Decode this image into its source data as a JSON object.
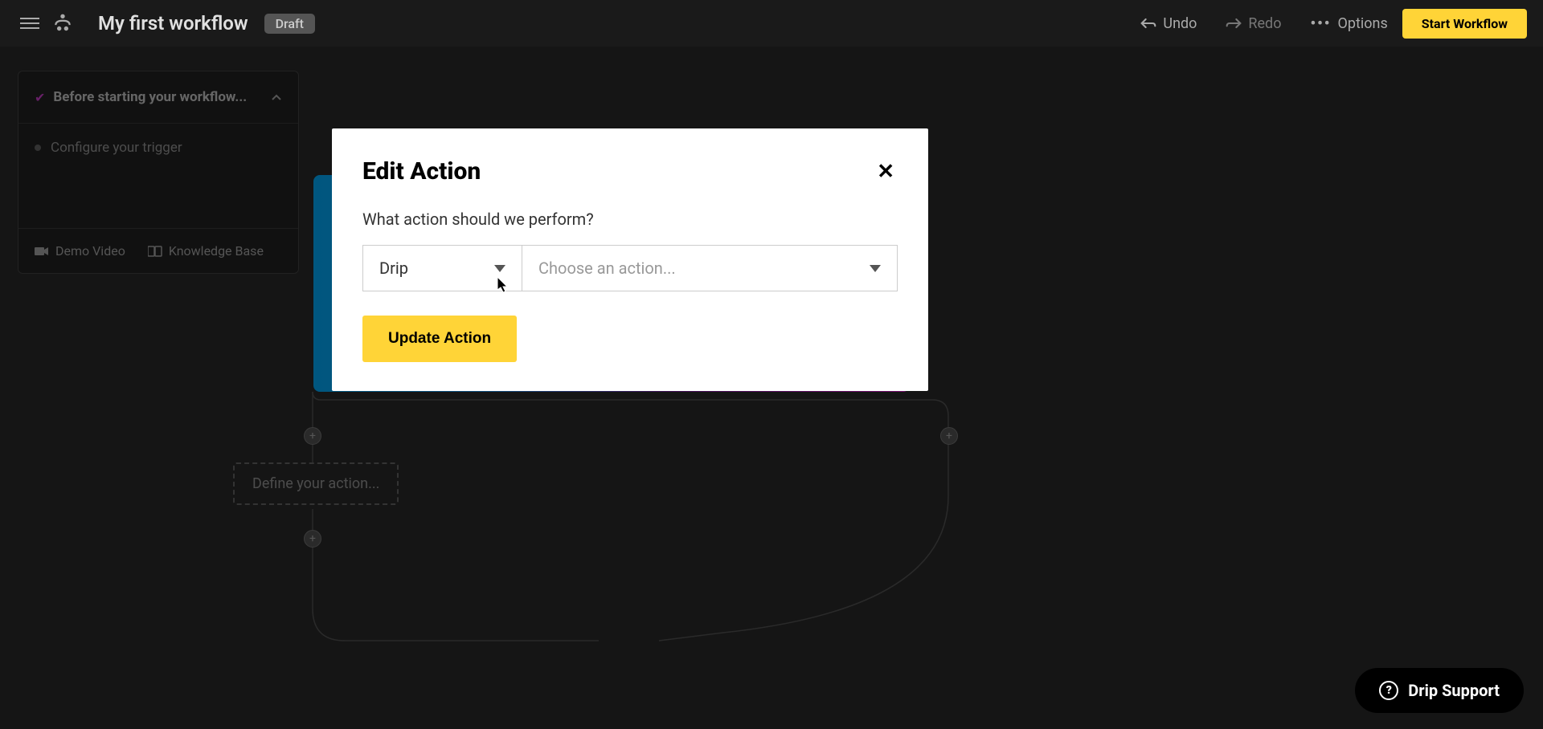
{
  "header": {
    "title": "My first workflow",
    "badge": "Draft",
    "undo": "Undo",
    "redo": "Redo",
    "options": "Options",
    "start": "Start Workflow"
  },
  "checklist": {
    "title": "Before starting your workflow...",
    "items": [
      "Configure your trigger"
    ],
    "demo_video": "Demo Video",
    "knowledge_base": "Knowledge Base"
  },
  "canvas": {
    "action_placeholder": "Define your action..."
  },
  "modal": {
    "title": "Edit Action",
    "label": "What action should we perform?",
    "provider_selected": "Drip",
    "action_placeholder": "Choose an action...",
    "submit": "Update Action"
  },
  "support": {
    "label": "Drip Support"
  }
}
